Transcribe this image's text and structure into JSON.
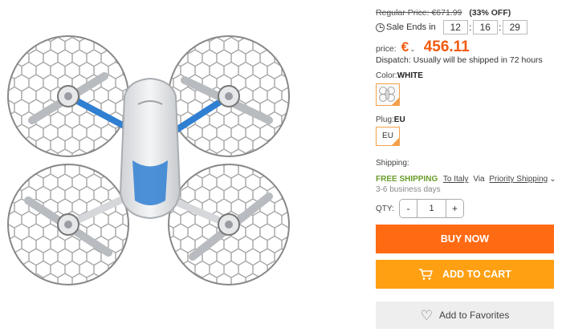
{
  "product": {
    "image_alt": "Quadcopter drone with hexagonal propeller guards"
  },
  "pricing": {
    "regular_label": "Regular Price: €671.99",
    "discount": "(33% OFF)",
    "sale_label": "Sale Ends in",
    "countdown": [
      "12",
      "16",
      "29"
    ],
    "price_label": "price:",
    "currency": "€",
    "price": "456.11"
  },
  "dispatch": "Dispatch: Usually will be shipped in 72 hours",
  "color": {
    "label": "Color:",
    "value": "WHITE"
  },
  "plug": {
    "label": "Plug:",
    "value": "EU",
    "options": [
      "EU"
    ]
  },
  "shipping": {
    "label": "Shipping:",
    "free": "FREE SHIPPING",
    "to": "To Italy",
    "via": "Via",
    "method": "Priority Shipping",
    "days": "3-6 business days"
  },
  "qty": {
    "label": "QTY:",
    "minus": "-",
    "value": "1",
    "plus": "+"
  },
  "buttons": {
    "buy": "BUY NOW",
    "cart": "ADD TO CART",
    "favorites": "Add to Favorites"
  },
  "colors": {
    "accent": "#f25a0f",
    "buy": "#ff6a13",
    "cart": "#ffa012",
    "free_shipping": "#6a9c2a",
    "selected_border": "#f3a04a"
  }
}
